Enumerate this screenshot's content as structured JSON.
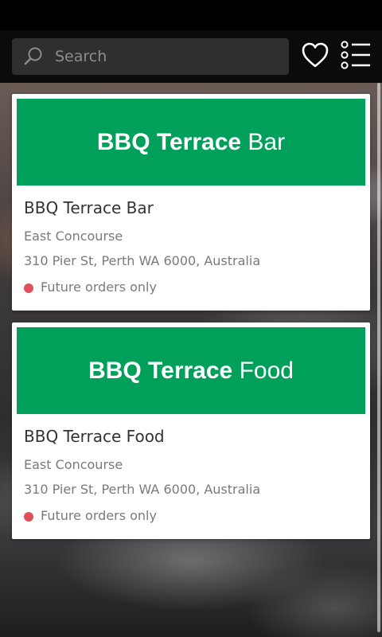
{
  "search": {
    "placeholder": "Search",
    "value": ""
  },
  "icons": {
    "search": "search-icon",
    "favorites": "heart-icon",
    "menu": "list-menu-icon"
  },
  "colors": {
    "banner": "#00a05b",
    "status_dot": "#e0505a",
    "header": "#0b0b0b"
  },
  "venues": [
    {
      "banner_bold": "BBQ Terrace",
      "banner_light": "Bar",
      "name": "BBQ Terrace Bar",
      "area": "East Concourse",
      "address": "310 Pier St, Perth WA 6000, Australia",
      "status": "Future orders only"
    },
    {
      "banner_bold": "BBQ Terrace",
      "banner_light": "Food",
      "name": "BBQ Terrace Food",
      "area": "East Concourse",
      "address": "310 Pier St, Perth WA 6000, Australia",
      "status": "Future orders only"
    }
  ]
}
